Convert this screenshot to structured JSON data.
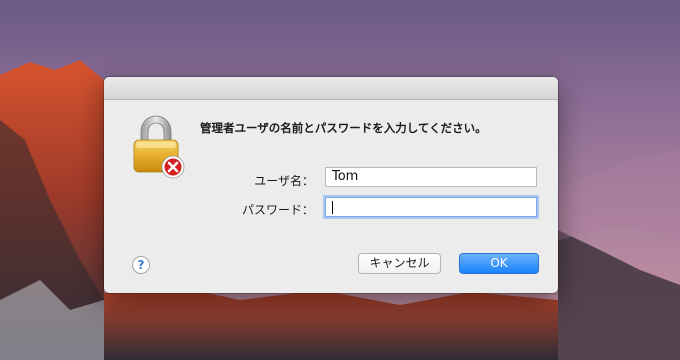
{
  "dialog": {
    "message": "管理者ユーザの名前とパスワードを入力してください。",
    "username_label": "ユーザ名：",
    "username_value": "Tom",
    "password_label": "パスワード：",
    "password_value": "",
    "help_label": "?",
    "cancel_label": "キャンセル",
    "ok_label": "OK"
  },
  "icons": {
    "lock": "lock-icon",
    "error_badge": "error-badge-icon",
    "help": "help-icon"
  },
  "colors": {
    "ok_button": "#1a82fb",
    "error_badge": "#d0201f",
    "focus_ring": "#a9c8f2"
  }
}
